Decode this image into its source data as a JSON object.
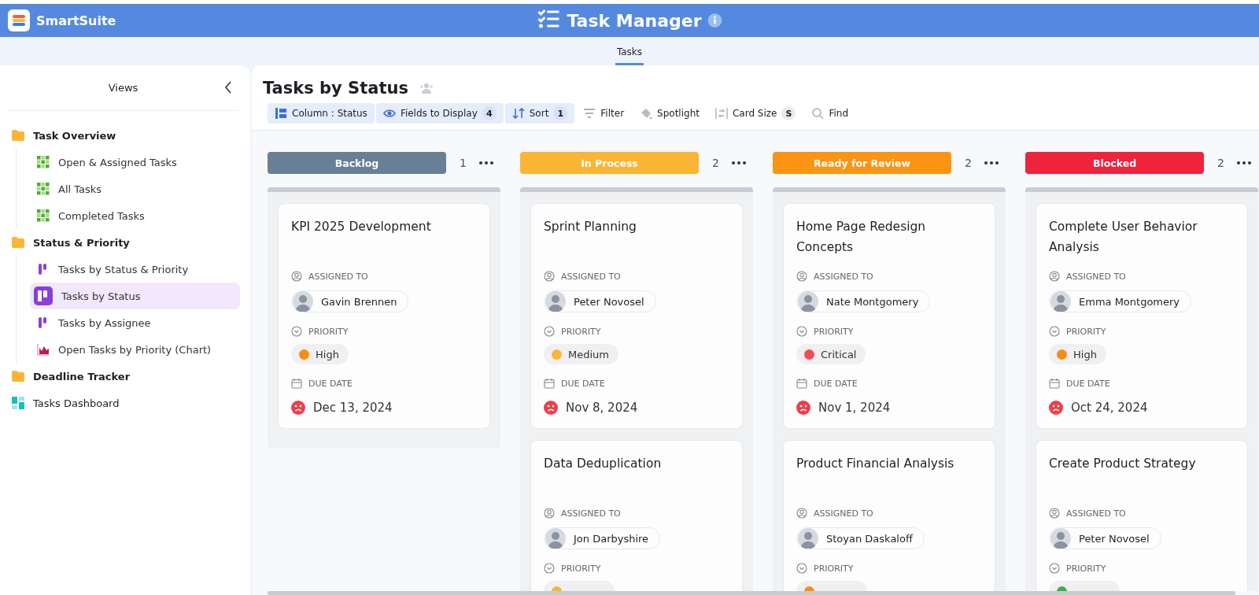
{
  "app": {
    "name": "SmartSuite"
  },
  "header": {
    "title": "Task Manager"
  },
  "tabs": [
    {
      "label": "Tasks",
      "selected": true
    }
  ],
  "sidebar": {
    "title": "Views",
    "items": [
      {
        "kind": "folder",
        "label": "Task Overview",
        "selected": false,
        "children": [
          {
            "kind": "grid",
            "label": "Open & Assigned Tasks",
            "selected": false
          },
          {
            "kind": "grid",
            "label": "All Tasks",
            "selected": false
          },
          {
            "kind": "grid",
            "label": "Completed Tasks",
            "selected": false
          }
        ]
      },
      {
        "kind": "folder",
        "label": "Status & Priority",
        "selected": false,
        "children": [
          {
            "kind": "kanban",
            "label": "Tasks by Status & Priority",
            "selected": false
          },
          {
            "kind": "kanban",
            "label": "Tasks by Status",
            "selected": true
          },
          {
            "kind": "kanban",
            "label": "Tasks by Assignee",
            "selected": false
          },
          {
            "kind": "chart",
            "label": "Open Tasks by Priority (Chart)",
            "selected": false
          }
        ]
      },
      {
        "kind": "folder",
        "label": "Deadline Tracker",
        "selected": false
      },
      {
        "kind": "dashboard",
        "label": "Tasks Dashboard",
        "selected": false
      }
    ]
  },
  "view": {
    "title": "Tasks by Status",
    "toolbar": [
      {
        "kind": "column",
        "label": "Column : Status",
        "active": true
      },
      {
        "kind": "fields",
        "label": "Fields to Display",
        "count": "4",
        "active": true
      },
      {
        "kind": "sort",
        "label": "Sort",
        "count": "1",
        "active": true
      },
      {
        "kind": "filter",
        "label": "Filter",
        "active": false
      },
      {
        "kind": "spotlight",
        "label": "Spotlight",
        "active": false
      },
      {
        "kind": "card_size",
        "label": "Card Size",
        "count": "S",
        "active": false
      },
      {
        "kind": "find",
        "label": "Find",
        "active": false
      }
    ]
  },
  "board": {
    "columns": [
      {
        "title": "Backlog",
        "color": "#687f96",
        "count": "1",
        "cards": [
          {
            "title": "KPI 2025 Development",
            "assigned_label": "ASSIGNED TO",
            "assignee": "Gavin Brennen",
            "priority_label": "PRIORITY",
            "priority": {
              "label": "High",
              "color": "#fb8c10"
            },
            "due_label": "DUE DATE",
            "due": "Dec 13, 2024",
            "overdue": true
          }
        ]
      },
      {
        "title": "In Process",
        "color": "#fbb534",
        "count": "2",
        "cards": [
          {
            "title": "Sprint Planning",
            "assigned_label": "ASSIGNED TO",
            "assignee": "Peter Novosel",
            "priority_label": "PRIORITY",
            "priority": {
              "label": "Medium",
              "color": "#fbb534"
            },
            "due_label": "DUE DATE",
            "due": "Nov 8, 2024",
            "overdue": true
          },
          {
            "title": "Data Deduplication",
            "assigned_label": "ASSIGNED TO",
            "assignee": "Jon Darbyshire",
            "priority_label": "PRIORITY",
            "priority": {
              "color": "#fbb534"
            }
          }
        ]
      },
      {
        "title": "Ready for Review",
        "color": "#fb9313",
        "count": "2",
        "cards": [
          {
            "title": "Home Page Redesign Concepts",
            "assigned_label": "ASSIGNED TO",
            "assignee": "Nate Montgomery",
            "priority_label": "PRIORITY",
            "priority": {
              "label": "Critical",
              "color": "#f44c55"
            },
            "due_label": "DUE DATE",
            "due": "Nov 1, 2024",
            "overdue": true
          },
          {
            "title": "Product Financial Analysis",
            "assigned_label": "ASSIGNED TO",
            "assignee": "Stoyan Daskaloff",
            "priority_label": "PRIORITY",
            "priority": {
              "color": "#fb8c10"
            }
          }
        ]
      },
      {
        "title": "Blocked",
        "color": "#ef233c",
        "count": "2",
        "cards": [
          {
            "title": "Complete User Behavior Analysis",
            "assigned_label": "ASSIGNED TO",
            "assignee": "Emma Montgomery",
            "priority_label": "PRIORITY",
            "priority": {
              "label": "High",
              "color": "#fb8c10"
            },
            "due_label": "DUE DATE",
            "due": "Oct 24, 2024",
            "overdue": true
          },
          {
            "title": "Create Product Strategy",
            "assigned_label": "ASSIGNED TO",
            "assignee": "Peter Novosel",
            "priority_label": "PRIORITY",
            "priority": {
              "color": "#3cb043"
            }
          }
        ]
      }
    ]
  }
}
